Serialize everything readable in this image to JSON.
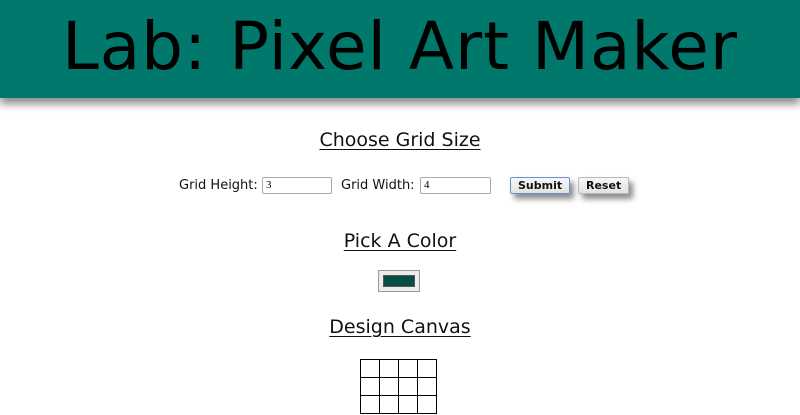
{
  "header": {
    "title": "Lab: Pixel Art Maker",
    "background": "#00786b"
  },
  "grid_size": {
    "heading": "Choose Grid Size",
    "height_label": "Grid Height:",
    "height_value": "3",
    "width_label": "Grid Width:",
    "width_value": "4",
    "submit_label": "Submit",
    "reset_label": "Reset"
  },
  "color": {
    "heading": "Pick A Color",
    "selected_color": "#054d45"
  },
  "canvas": {
    "heading": "Design Canvas",
    "rows": 3,
    "columns": 4
  }
}
